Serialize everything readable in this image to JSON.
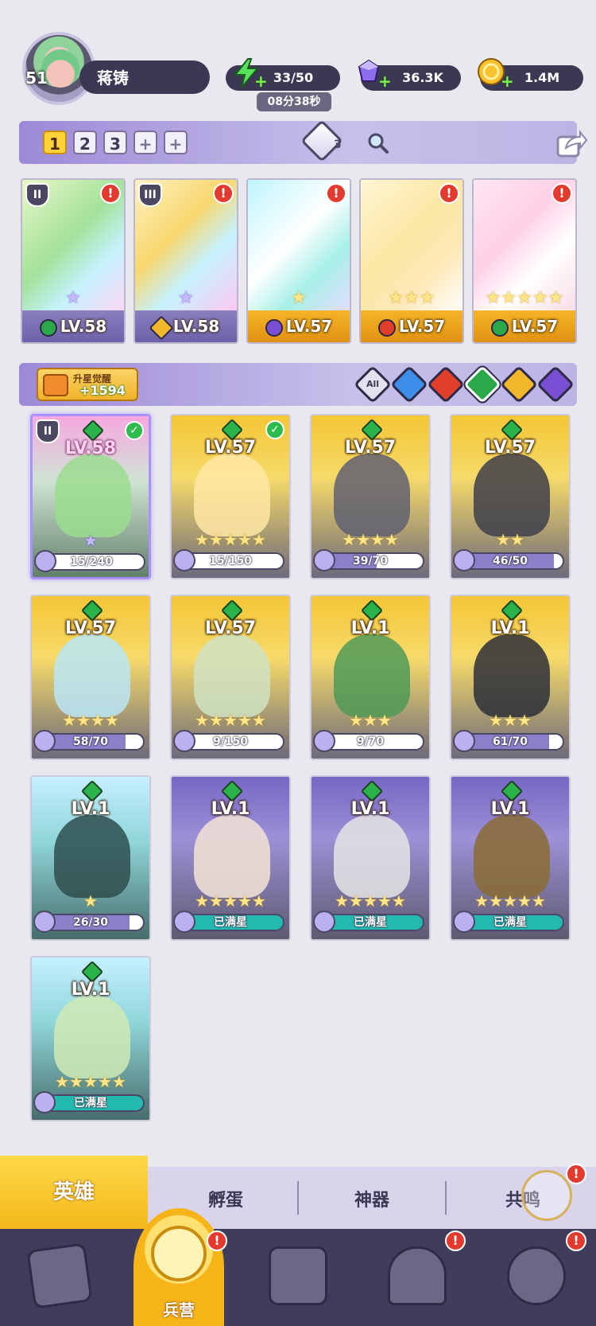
{
  "player": {
    "level": "51",
    "name": "蒋铸"
  },
  "resources": {
    "energy": "33/50",
    "energy_timer": "08分38秒",
    "gems": "36.3K",
    "coins": "1.4M"
  },
  "team_tabs": [
    "1",
    "2",
    "3",
    "+",
    "+"
  ],
  "rank_level": "3",
  "team": [
    {
      "level": "LV.58",
      "element": "green",
      "frame": "purple",
      "rank": "II",
      "stars": "★"
    },
    {
      "level": "LV.58",
      "element": "gold",
      "frame": "purple",
      "rank": "III",
      "stars": "★"
    },
    {
      "level": "LV.57",
      "element": "purple",
      "frame": "gold",
      "rank": "",
      "stars": "★"
    },
    {
      "level": "LV.57",
      "element": "red",
      "frame": "gold",
      "rank": "",
      "stars": "★★★"
    },
    {
      "level": "LV.57",
      "element": "green",
      "frame": "gold",
      "rank": "",
      "stars": "★★★★★"
    }
  ],
  "awaken": {
    "label": "升星觉醒",
    "value": "+1594"
  },
  "filters": {
    "all_label": "All",
    "elements": [
      "water",
      "fire",
      "earth",
      "light",
      "dark"
    ]
  },
  "heroes": [
    {
      "level": "LV.58",
      "progress": "15/240",
      "fill": 0.06,
      "bg": "pink",
      "stars": "★",
      "checked": true,
      "rank": "II"
    },
    {
      "level": "LV.57",
      "progress": "15/150",
      "fill": 0.1,
      "bg": "gold",
      "stars": "★★★★★",
      "checked": true,
      "rank": ""
    },
    {
      "level": "LV.57",
      "progress": "39/70",
      "fill": 0.56,
      "bg": "gold",
      "stars": "★★★★",
      "checked": false,
      "rank": ""
    },
    {
      "level": "LV.57",
      "progress": "46/50",
      "fill": 0.92,
      "bg": "gold",
      "stars": "★★",
      "checked": false,
      "rank": ""
    },
    {
      "level": "LV.57",
      "progress": "58/70",
      "fill": 0.83,
      "bg": "gold",
      "stars": "★★★★",
      "checked": false,
      "rank": ""
    },
    {
      "level": "LV.57",
      "progress": "9/150",
      "fill": 0.06,
      "bg": "gold",
      "stars": "★★★★★",
      "checked": false,
      "rank": ""
    },
    {
      "level": "LV.1",
      "progress": "9/70",
      "fill": 0.13,
      "bg": "gold",
      "stars": "★★★",
      "checked": false,
      "rank": ""
    },
    {
      "level": "LV.1",
      "progress": "61/70",
      "fill": 0.87,
      "bg": "gold",
      "stars": "★★★",
      "checked": false,
      "rank": ""
    },
    {
      "level": "LV.1",
      "progress": "26/30",
      "fill": 0.87,
      "bg": "cyan",
      "stars": "★",
      "checked": false,
      "rank": ""
    },
    {
      "level": "LV.1",
      "progress": "已满星",
      "fill": 1,
      "bg": "purple",
      "stars": "★★★★★",
      "checked": false,
      "rank": ""
    },
    {
      "level": "LV.1",
      "progress": "已满星",
      "fill": 1,
      "bg": "purple",
      "stars": "★★★★★",
      "checked": false,
      "rank": ""
    },
    {
      "level": "LV.1",
      "progress": "已满星",
      "fill": 1,
      "bg": "purple",
      "stars": "★★★★★",
      "checked": false,
      "rank": ""
    },
    {
      "level": "LV.1",
      "progress": "已满星",
      "fill": 1,
      "bg": "cyan",
      "stars": "★★★★★",
      "checked": false,
      "rank": ""
    }
  ],
  "sub_tabs": {
    "active": "英雄",
    "items": [
      "孵蛋",
      "神器",
      "共鸣"
    ]
  },
  "nav": {
    "active_label": "兵营"
  },
  "colors": {
    "accent_gold": "#f4b91b",
    "accent_purple": "#9b8ad7",
    "nav_bg": "#3f3d5b",
    "notify_red": "#e23a2e"
  }
}
